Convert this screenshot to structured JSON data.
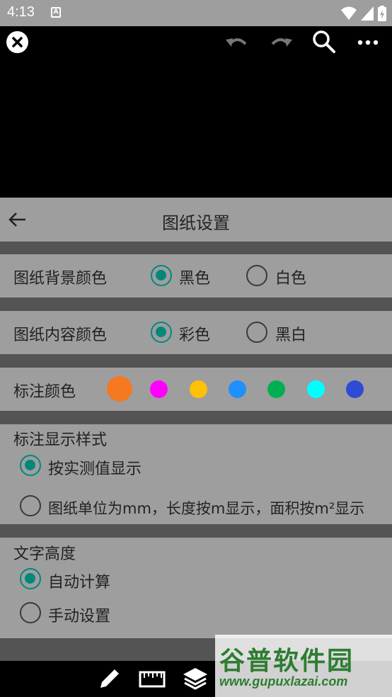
{
  "status_bar": {
    "time": "4:13",
    "notification_icon": "A"
  },
  "toolbar": {
    "icons": [
      "close-icon",
      "undo-icon",
      "redo-icon",
      "search-icon",
      "more-icon"
    ]
  },
  "dialog": {
    "title": "图纸设置",
    "background_color": {
      "label": "图纸背景颜色",
      "options": [
        {
          "label": "黑色",
          "selected": true
        },
        {
          "label": "白色",
          "selected": false
        }
      ]
    },
    "content_color": {
      "label": "图纸内容颜色",
      "options": [
        {
          "label": "彩色",
          "selected": true
        },
        {
          "label": "黑白",
          "selected": false
        }
      ]
    },
    "annotation_color": {
      "label": "标注颜色",
      "swatches": [
        "#f47920",
        "#ff00ff",
        "#ffc107",
        "#1e90ff",
        "#00b050",
        "#00ffff",
        "#2f4bd6"
      ],
      "selected_index": 0
    },
    "annotation_style": {
      "label": "标注显示样式",
      "options": [
        {
          "label": "按实测值显示",
          "selected": true
        },
        {
          "label": "图纸单位为mm，长度按m显示，面积按m²显示",
          "selected": false
        }
      ]
    },
    "text_height": {
      "label": "文字高度",
      "options": [
        {
          "label": "自动计算",
          "selected": true
        },
        {
          "label": "手动设置",
          "selected": false
        }
      ]
    }
  },
  "bottom_bar": {
    "icons": [
      "pencil-icon",
      "ruler-icon",
      "layers-icon"
    ]
  },
  "watermark": {
    "main": "谷普软件园",
    "sub": "www.gupuxlazai.com"
  },
  "colors": {
    "accent": "#00897b",
    "panel_bg": "#9e9e9e",
    "separator": "#545454"
  }
}
